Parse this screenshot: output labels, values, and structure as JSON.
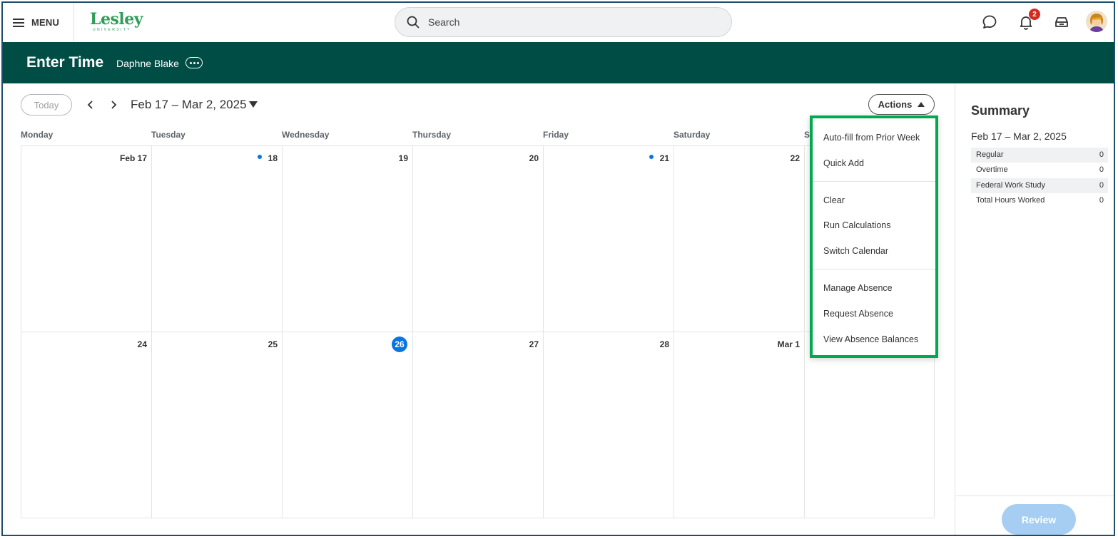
{
  "topbar": {
    "menu_label": "MENU",
    "logo_text": "Lesley",
    "logo_subtext": "UNIVERSITY",
    "search_placeholder": "Search",
    "notification_count": "2"
  },
  "header": {
    "title": "Enter Time",
    "worker_name": "Daphne Blake"
  },
  "toolbar": {
    "today_label": "Today",
    "date_range": "Feb 17 – Mar 2, 2025",
    "actions_label": "Actions"
  },
  "calendar": {
    "day_names": [
      "Monday",
      "Tuesday",
      "Wednesday",
      "Thursday",
      "Friday",
      "Saturday",
      "S"
    ],
    "week1": [
      "Feb 17",
      "18",
      "19",
      "20",
      "21",
      "22"
    ],
    "week2": [
      "24",
      "25",
      "26",
      "27",
      "28",
      "Mar 1"
    ]
  },
  "actions_menu": {
    "items": [
      "Auto-fill from Prior Week",
      "Quick Add",
      "Clear",
      "Run Calculations",
      "Switch Calendar",
      "Manage Absence",
      "Request Absence",
      "View Absence Balances"
    ]
  },
  "summary": {
    "title": "Summary",
    "date_range": "Feb 17 – Mar 2, 2025",
    "rows": [
      {
        "label": "Regular",
        "value": "0"
      },
      {
        "label": "Overtime",
        "value": "0"
      },
      {
        "label": "Federal Work Study",
        "value": "0"
      },
      {
        "label": "Total Hours Worked",
        "value": "0"
      }
    ],
    "review_label": "Review"
  },
  "colors": {
    "header_bg": "#004d45",
    "accent_blue": "#0875e1",
    "highlight_green": "#00a94f",
    "badge_red": "#d52b1e"
  }
}
